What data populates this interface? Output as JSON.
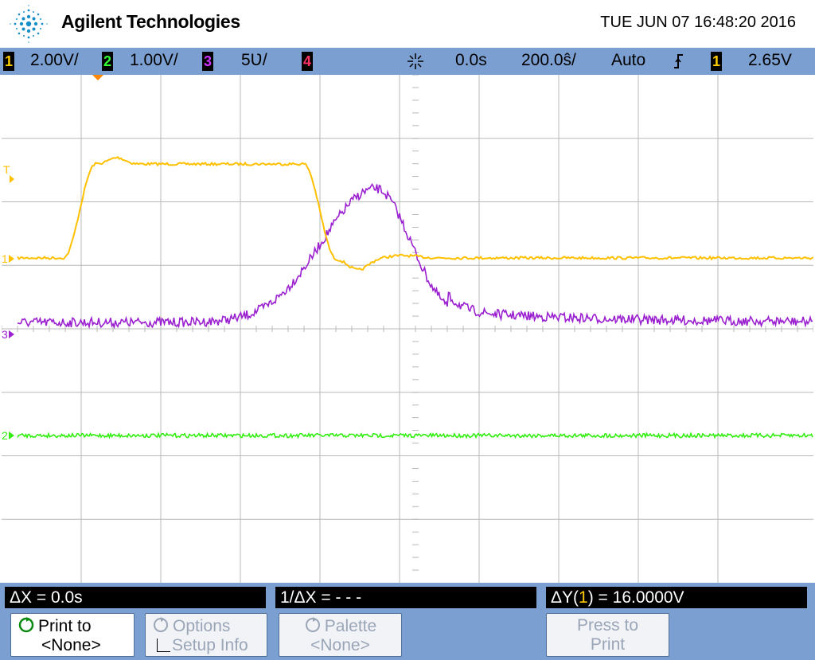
{
  "header": {
    "brand": "Agilent Technologies",
    "datetime": "TUE JUN 07 16:48:20 2016"
  },
  "status": {
    "ch1": {
      "num": "1",
      "scale": "2.00V/",
      "color": "#000000",
      "text_color": "#ffcc00"
    },
    "ch2": {
      "num": "2",
      "scale": "1.00V/",
      "color": "#000000",
      "text_color": "#33ff33"
    },
    "ch3": {
      "num": "3",
      "scale": "5Ʋ/",
      "color": "#000000",
      "text_color": "#cc33ff"
    },
    "ch4": {
      "num": "4",
      "color": "#000000",
      "text_color": "#ff3366"
    },
    "trig_icon": "trigger-position-icon",
    "delay": "0.0s",
    "timebase": "200.0ŝ/",
    "mode": "Auto",
    "edge_icon": "rising-edge-icon",
    "trig_source": "1",
    "trig_level": "2.65V"
  },
  "markers": {
    "t": "T",
    "ch1": "1",
    "ch3": "3",
    "ch2": "2"
  },
  "colors": {
    "ch1": "#ffc000",
    "ch2": "#33ee11",
    "ch3": "#9b20d0",
    "grid": "#b8b8b8",
    "bar": "#7b9fd0",
    "trigger_marker": "#ff8800"
  },
  "cursors": {
    "dx": "ΔX = 0.0s",
    "inv_dx": "1/ΔX = - - -",
    "dy_prefix": "ΔY(",
    "dy_source": "1",
    "dy_suffix": ") = 16.0000V"
  },
  "softkeys": [
    {
      "line1": "Print to",
      "line2": "<None>",
      "icon": "refresh-arrow-icon",
      "enabled": true
    },
    {
      "line1": "Options",
      "line2": "Setup Info",
      "icon": "refresh-arrow-icon",
      "enabled": false
    },
    {
      "line1": "Palette",
      "line2": "<None>",
      "icon": "refresh-arrow-icon",
      "enabled": false
    },
    {
      "line1": "Press to",
      "line2": "Print",
      "enabled": false
    }
  ]
}
